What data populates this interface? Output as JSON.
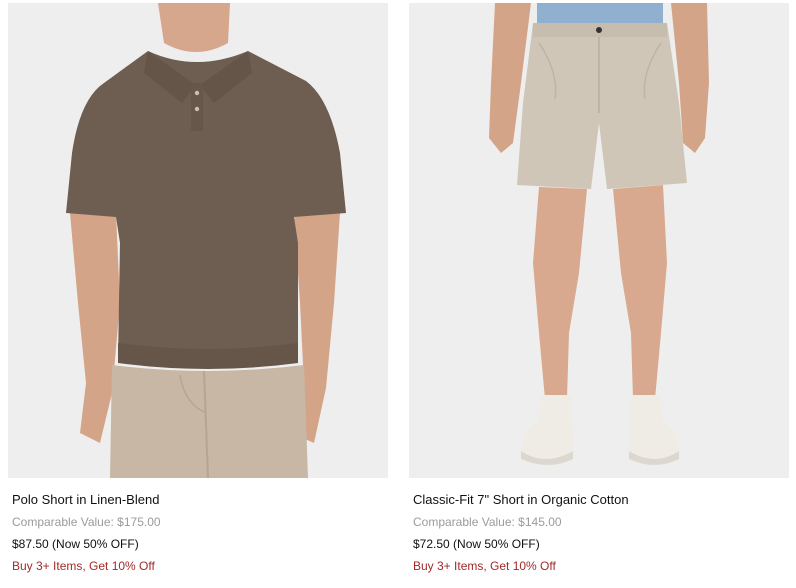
{
  "products": [
    {
      "title": "Polo Short in Linen-Blend",
      "comparable": "Comparable Value: $175.00",
      "price": "$87.50 (Now 50% OFF)",
      "promo": "Buy 3+ Items, Get 10% Off"
    },
    {
      "title": "Classic-Fit 7\" Short in Organic Cotton",
      "comparable": "Comparable Value: $145.00",
      "price": "$72.50 (Now 50% OFF)",
      "promo": "Buy 3+ Items, Get 10% Off"
    }
  ],
  "colors": {
    "image_bg": "#eeeeee",
    "promo": "#a12a2a",
    "muted": "#9b9b9b",
    "polo": "#6e5d51",
    "chino": "#c7b7a4",
    "short_khaki": "#cfc6b8",
    "skin": "#d8a98e"
  }
}
